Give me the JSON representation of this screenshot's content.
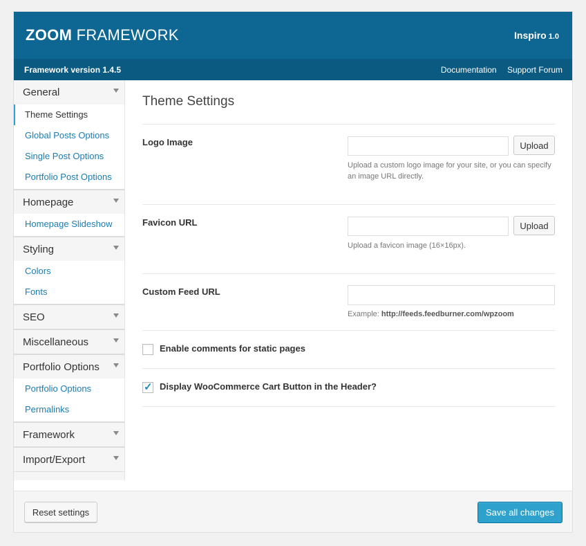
{
  "header": {
    "logo_bold": "ZOOM",
    "logo_thin": " FRAMEWORK",
    "theme_name": "Inspiro",
    "theme_version": "1.0"
  },
  "subbar": {
    "framework_version": "Framework version 1.4.5",
    "links": [
      "Documentation",
      "Support Forum"
    ]
  },
  "sidebar": {
    "groups": [
      {
        "label": "General",
        "items": [
          "Theme Settings",
          "Global Posts Options",
          "Single Post Options",
          "Portfolio Post Options"
        ]
      },
      {
        "label": "Homepage",
        "items": [
          "Homepage Slideshow"
        ]
      },
      {
        "label": "Styling",
        "items": [
          "Colors",
          "Fonts"
        ]
      },
      {
        "label": "SEO",
        "items": []
      },
      {
        "label": "Miscellaneous",
        "items": []
      },
      {
        "label": "Portfolio Options",
        "items": [
          "Portfolio Options",
          "Permalinks"
        ]
      },
      {
        "label": "Framework",
        "items": []
      },
      {
        "label": "Import/Export",
        "items": []
      }
    ],
    "active_item": "Theme Settings"
  },
  "main": {
    "title": "Theme Settings",
    "logo": {
      "label": "Logo Image",
      "value": "",
      "button": "Upload",
      "help": "Upload a custom logo image for your site, or you can specify an image URL directly."
    },
    "favicon": {
      "label": "Favicon URL",
      "value": "",
      "button": "Upload",
      "help": "Upload a favicon image (16×16px)."
    },
    "feed": {
      "label": "Custom Feed URL",
      "value": "",
      "help_prefix": "Example: ",
      "help_example": "http://feeds.feedburner.com/wpzoom"
    },
    "comments_static": {
      "label": "Enable comments for static pages",
      "checked": false
    },
    "woo_cart": {
      "label": "Display WooCommerce Cart Button in the Header?",
      "checked": true
    }
  },
  "footer": {
    "reset_label": "Reset settings",
    "save_label": "Save all changes"
  },
  "colors": {
    "header_bg": "#0e6692",
    "subbar_bg": "#0a5a82",
    "link": "#1a7cb3",
    "primary_button": "#2ea2cc"
  }
}
